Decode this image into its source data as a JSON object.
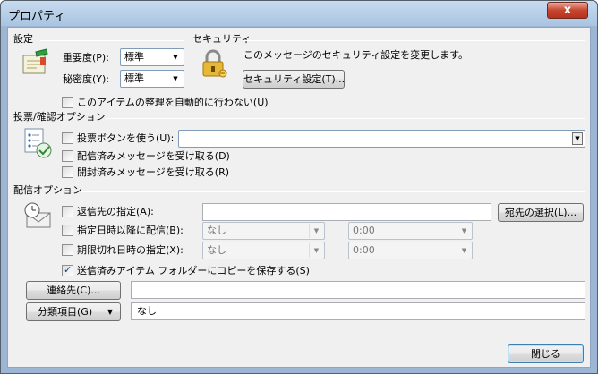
{
  "window": {
    "title": "プロパティ",
    "close_glyph": "x"
  },
  "settings": {
    "heading": "設定",
    "importance_label": "重要度(P):",
    "importance_value": "標準",
    "sensitivity_label": "秘密度(Y):",
    "sensitivity_value": "標準",
    "no_auto_archive_label": "このアイテムの整理を自動的に行わない(U)"
  },
  "security": {
    "heading": "セキュリティ",
    "description": "このメッセージのセキュリティ設定を変更します。",
    "button_label": "セキュリティ設定(T)..."
  },
  "voting": {
    "heading": "投票/確認オプション",
    "use_voting_label": "投票ボタンを使う(U):",
    "use_voting_value": "",
    "delivery_receipt_label": "配信済みメッセージを受け取る(D)",
    "read_receipt_label": "開封済みメッセージを受け取る(R)"
  },
  "delivery": {
    "heading": "配信オプション",
    "reply_to_label": "返信先の指定(A):",
    "reply_to_value": "",
    "select_names_button": "宛先の選択(L)...",
    "defer_label": "指定日時以降に配信(B):",
    "defer_date": "なし",
    "defer_time": "0:00",
    "expire_label": "期限切れ日時の指定(X):",
    "expire_date": "なし",
    "expire_time": "0:00",
    "save_sent_label": "送信済みアイテム フォルダーにコピーを保存する(S)",
    "save_sent_checked": true
  },
  "contacts": {
    "button_label": "連絡先(C)...",
    "value": ""
  },
  "categories": {
    "button_label": "分類項目(G)",
    "value": "なし"
  },
  "footer": {
    "close_button": "閉じる"
  }
}
